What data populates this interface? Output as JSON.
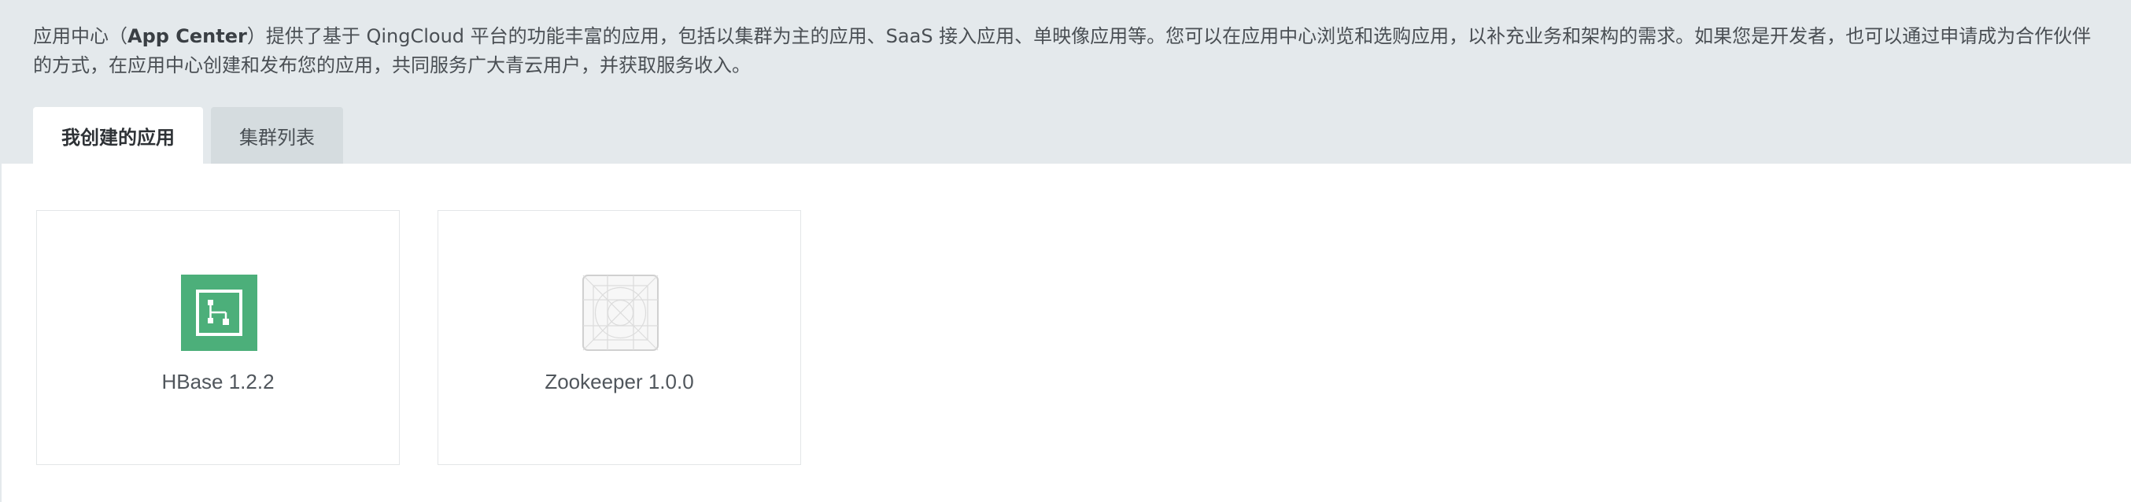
{
  "intro": {
    "part1": "应用中心（",
    "strong": "App Center",
    "part2": "）提供了基于 QingCloud 平台的功能丰富的应用，包括以集群为主的应用、SaaS 接入应用、单映像应用等。您可以在应用中心浏览和选购应用，以补充业务和架构的需求。如果您是开发者，也可以通过申请成为合作伙伴的方式，在应用中心创建和发布您的应用，共同服务广大青云用户，并获取服务收入。"
  },
  "tabs": [
    {
      "label": "我创建的应用",
      "active": true
    },
    {
      "label": "集群列表",
      "active": false
    }
  ],
  "apps": [
    {
      "name": "HBase 1.2.2",
      "icon": "hbase-icon",
      "icon_color": "#4caf7a"
    },
    {
      "name": "Zookeeper 1.0.0",
      "icon": "zookeeper-placeholder-icon",
      "icon_color": "#d8d8d8"
    }
  ],
  "colors": {
    "header_bg": "#e4e9ec",
    "tab_inactive_bg": "#d5dcdf",
    "accent_green": "#4caf7a"
  }
}
